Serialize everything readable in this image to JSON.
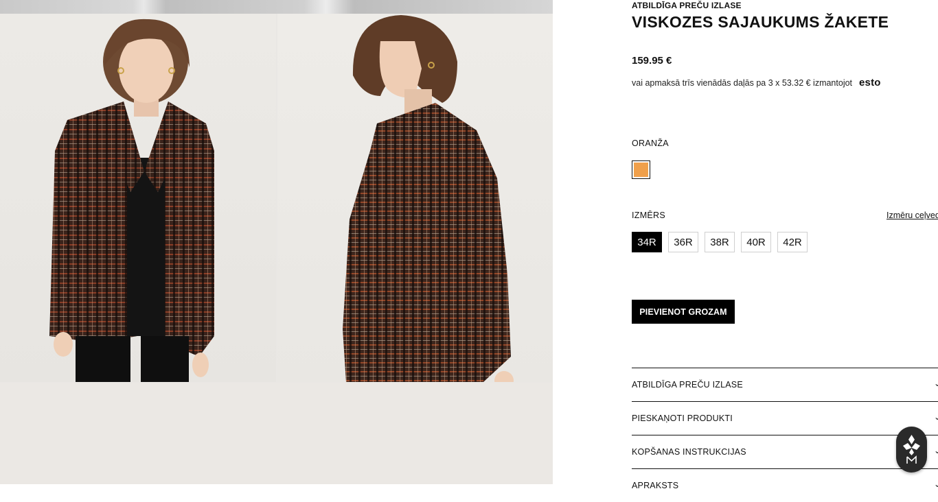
{
  "product": {
    "eyebrow": "ATBILDĪGA PREČU IZLASE",
    "title": "VISKOZES SAJAUKUMS ŽAKETE",
    "price": "159.95 €",
    "installments_text": "vai apmaksā trīs vienādās daļās pa 3 x 53.32 € izmantojot",
    "installments_provider": "esto"
  },
  "color": {
    "label": "ORANŽA",
    "swatch_hex": "#f0a04b"
  },
  "size": {
    "label": "IZMĒRS",
    "guide_link": "Izmēru ceļvedis",
    "options": [
      "34R",
      "36R",
      "38R",
      "40R",
      "42R"
    ],
    "selected": "34R"
  },
  "cart": {
    "button_label": "PIEVIENOT GROZAM"
  },
  "accordion": [
    {
      "label": "ATBILDĪGA PREČU IZLASE"
    },
    {
      "label": "PIESKAŅOTI PRODUKTI"
    },
    {
      "label": "KOPŠANAS INSTRUKCIJAS"
    },
    {
      "label": "APRAKSTS"
    }
  ],
  "icons": {
    "accordion_chevron": "chevron-down-icon",
    "badge": "brand-badge-icon"
  }
}
